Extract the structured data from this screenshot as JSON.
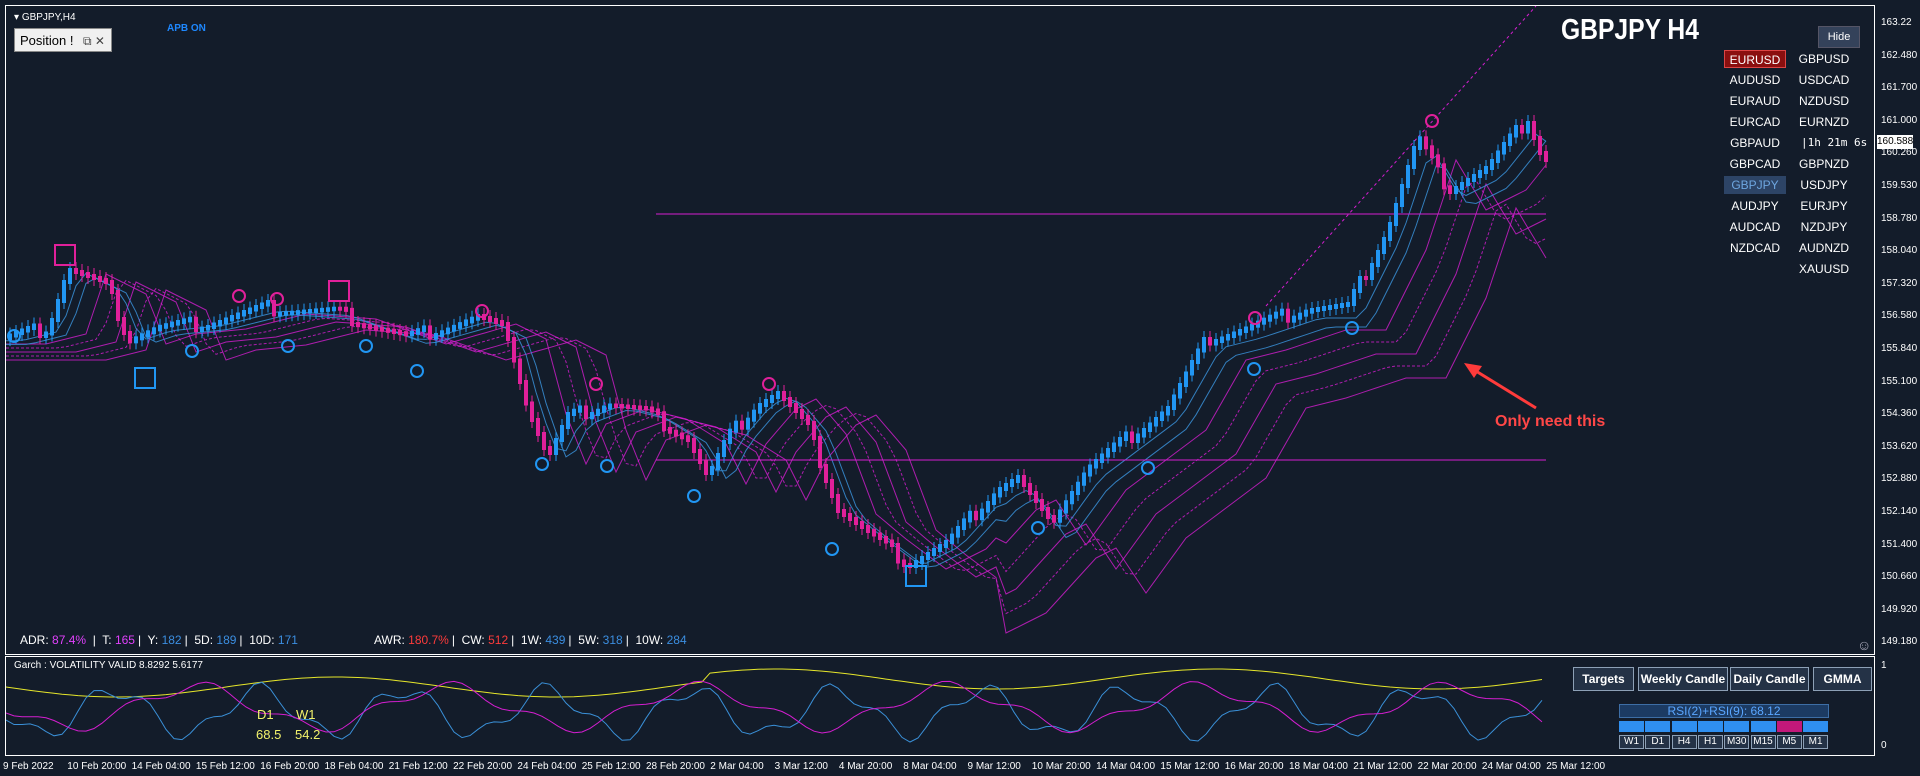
{
  "header": {
    "symbol": "GBPJPY,H4",
    "apb": "APB ON",
    "title": "GBPJPY H4"
  },
  "position_panel": {
    "label": "Position !",
    "controls": "⧉ ✕"
  },
  "hide_button": "Hide",
  "pairs_left": [
    "EURUSD",
    "AUDUSD",
    "EURAUD",
    "EURCAD",
    "GBPAUD",
    "GBPCAD",
    "GBPJPY",
    "AUDJPY",
    "AUDCAD",
    "NZDCAD"
  ],
  "pairs_right": [
    "GBPUSD",
    "USDCAD",
    "NZDUSD",
    "EURNZD",
    "|1h 21m 6s",
    "GBPNZD",
    "USDJPY",
    "EURJPY",
    "NZDJPY",
    "AUDNZD",
    "XAUUSD"
  ],
  "selected_pair_red": "EURUSD",
  "selected_pair_blue": "GBPJPY",
  "stats": {
    "adr_label": "ADR: ",
    "adr_value": "87.4%",
    "t_label": "  |  T: ",
    "t_value": "165",
    "y_label": "|  Y: ",
    "y_value": "182",
    "d5_label": "|  5D: ",
    "d5_value": "189",
    "d10_label": "|  10D: ",
    "d10_value": "171",
    "awr_label": "AWR: ",
    "awr_value": "180.7%",
    "cw_label": "|  CW: ",
    "cw_value": "512",
    "w1_label": "|  1W: ",
    "w1_value": "439",
    "w5_label": "|  5W: ",
    "w5_value": "318",
    "w10_label": "|  10W: ",
    "w10_value": "284"
  },
  "annotation": "Only need this",
  "oscillator": {
    "label": "Garch : VOLATILITY VALID 8.8292 5.6177",
    "d1_label": "D1",
    "w1_label": "W1",
    "d1_value": "68.5",
    "w1_value": "54.2",
    "axis_top": "1",
    "axis_bottom": "0"
  },
  "buttons": [
    "Targets",
    "Weekly Candle",
    "Daily Candle",
    "GMMA"
  ],
  "rsi_text": "RSI(2)+RSI(9):  68.12",
  "timeframes": [
    "W1",
    "D1",
    "H4",
    "H1",
    "M30",
    "M15",
    "M5",
    "M1"
  ],
  "price_labels": [
    "163.22",
    "162.480",
    "161.700",
    "161.000",
    "160.260",
    "159.530",
    "158.780",
    "158.040",
    "157.320",
    "156.580",
    "155.840",
    "155.100",
    "154.360",
    "153.620",
    "152.880",
    "152.140",
    "151.400",
    "150.660",
    "149.920",
    "149.180"
  ],
  "current_price": "160.588",
  "time_labels": [
    "9 Feb 2022",
    "10 Feb 20:00",
    "14 Feb 04:00",
    "15 Feb 12:00",
    "16 Feb 20:00",
    "18 Feb 04:00",
    "21 Feb 12:00",
    "22 Feb 20:00",
    "24 Feb 04:00",
    "25 Feb 12:00",
    "28 Feb 20:00",
    "2 Mar 04:00",
    "3 Mar 12:00",
    "4 Mar 20:00",
    "8 Mar 04:00",
    "9 Mar 12:00",
    "10 Mar 20:00",
    "14 Mar 04:00",
    "15 Mar 12:00",
    "16 Mar 20:00",
    "18 Mar 04:00",
    "21 Mar 12:00",
    "22 Mar 20:00",
    "24 Mar 04:00",
    "25 Mar 12:00"
  ],
  "colors": {
    "bull": "#2196f3",
    "bear": "#e0209a",
    "ribbon_magenta": "#d41ed0",
    "ribbon_blue": "#3a90d8",
    "signal_yellow": "#e6e62a",
    "background": "#131c2a"
  }
}
